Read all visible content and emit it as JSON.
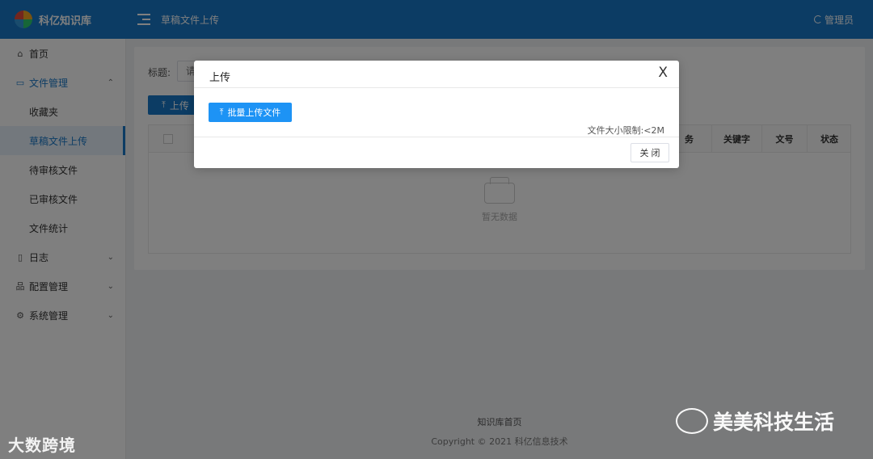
{
  "header": {
    "brand": "科亿知识库",
    "page_title": "草稿文件上传",
    "user": "管理员"
  },
  "sidebar": {
    "items": [
      {
        "label": "首页"
      },
      {
        "label": "文件管理",
        "subitems": [
          "收藏夹",
          "草稿文件上传",
          "待审核文件",
          "已审核文件",
          "文件统计"
        ]
      },
      {
        "label": "日志"
      },
      {
        "label": "配置管理"
      },
      {
        "label": "系统管理"
      }
    ]
  },
  "main": {
    "filter_label": "标题:",
    "filter_placeholder": "请",
    "upload_label": "上传",
    "table_headers": [
      "务",
      "关键字",
      "文号",
      "状态"
    ],
    "empty_text": "暂无数据"
  },
  "footer": {
    "link": "知识库首页",
    "copyright": "Copyright © 2021 科亿信息技术"
  },
  "modal": {
    "title": "上传",
    "close_symbol": "X",
    "batch_upload_label": "批量上传文件",
    "size_limit": "文件大小限制:<2M",
    "close_button": "关 闭"
  },
  "watermarks": {
    "left": "大数跨境",
    "right": "美美科技生活"
  }
}
